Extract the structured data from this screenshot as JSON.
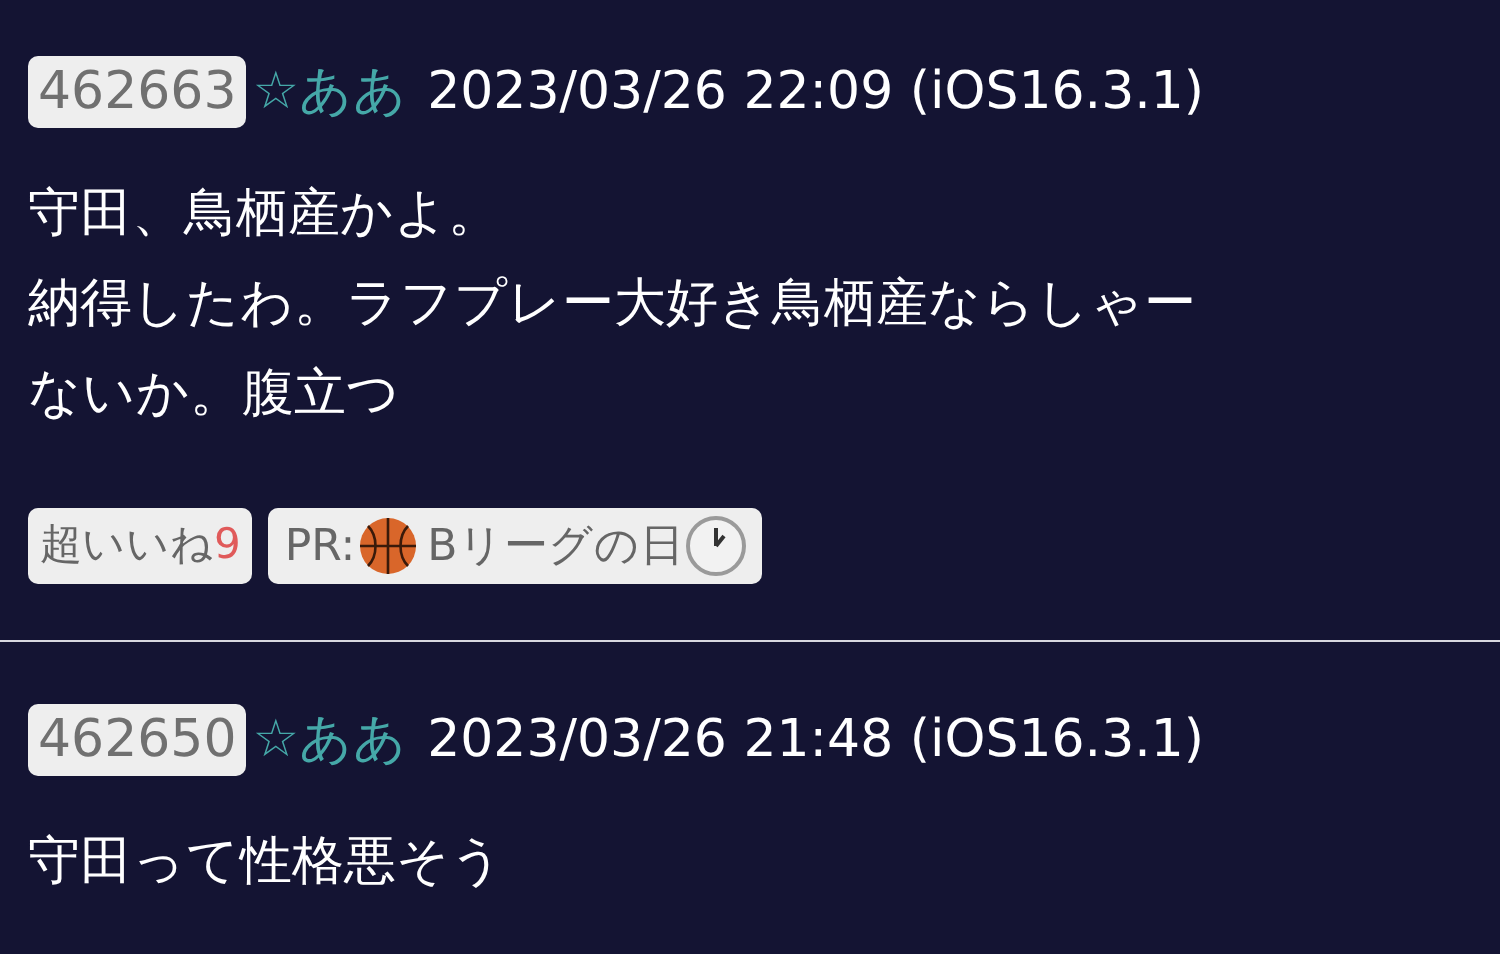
{
  "posts": [
    {
      "number": "462663",
      "name": "☆ああ",
      "date": "2023/03/26 22:09 (iOS16.3.1)",
      "lines": [
        "守田、鳥栖産かよ。",
        "納得したわ。ラフプレー大好き鳥栖産ならしゃー",
        "ないか。腹立つ"
      ],
      "like": {
        "label": "超いいね",
        "count": "9"
      },
      "ad": {
        "prefix": "PR:",
        "text": "Bリーグの日"
      }
    },
    {
      "number": "462650",
      "name": "☆ああ",
      "date": "2023/03/26 21:48 (iOS16.3.1)",
      "lines": [
        "守田って性格悪そう"
      ]
    }
  ]
}
